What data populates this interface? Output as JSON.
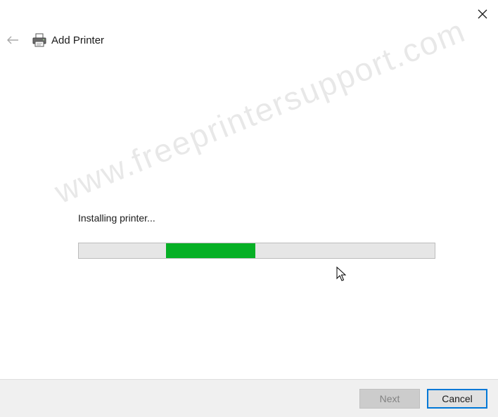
{
  "window": {
    "title": "Add Printer",
    "close_icon": "close-icon",
    "back_icon": "back-arrow-icon",
    "printer_icon": "printer-icon"
  },
  "main": {
    "status_text": "Installing printer...",
    "progress": {
      "indeterminate": true,
      "fill_color": "#06b025",
      "track_color": "#e6e6e6"
    },
    "watermark": "www.freeprintersupport.com"
  },
  "footer": {
    "next_label": "Next",
    "next_enabled": false,
    "cancel_label": "Cancel",
    "accent": "#0078d7"
  }
}
